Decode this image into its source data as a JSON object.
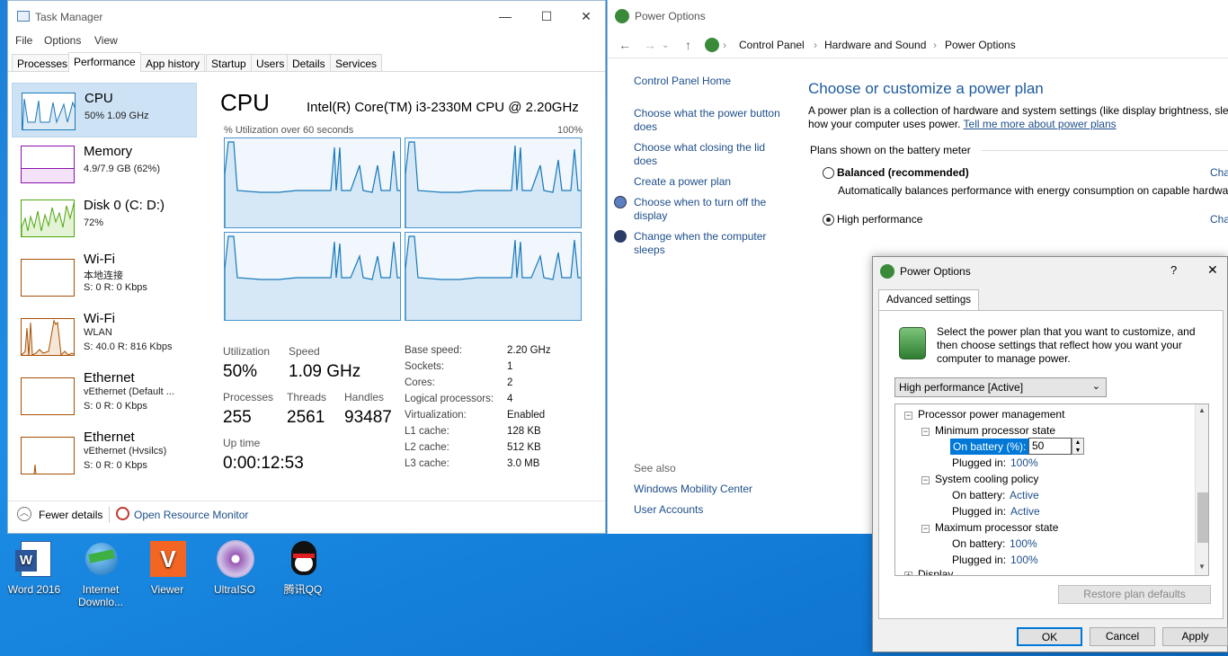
{
  "taskmanager": {
    "title": "Task Manager",
    "menu": [
      "File",
      "Options",
      "View"
    ],
    "tabs": [
      "Processes",
      "Performance",
      "App history",
      "Startup",
      "Users",
      "Details",
      "Services"
    ],
    "sidebar": [
      {
        "name": "CPU",
        "l1": "50%  1.09 GHz",
        "l2": ""
      },
      {
        "name": "Memory",
        "l1": "4.9/7.9 GB (62%)",
        "l2": ""
      },
      {
        "name": "Disk 0 (C: D:)",
        "l1": "72%",
        "l2": ""
      },
      {
        "name": "Wi-Fi",
        "l1": "本地连接",
        "l2": "S: 0 R: 0 Kbps"
      },
      {
        "name": "Wi-Fi",
        "l1": "WLAN",
        "l2": "S: 40.0 R: 816 Kbps"
      },
      {
        "name": "Ethernet",
        "l1": "vEthernet (Default ...",
        "l2": "S: 0 R: 0 Kbps"
      },
      {
        "name": "Ethernet",
        "l1": "vEthernet (Hvsilcs)",
        "l2": "S: 0 R: 0 Kbps"
      }
    ],
    "cpu": {
      "title": "CPU",
      "model": "Intel(R) Core(TM) i3-2330M CPU @ 2.20GHz",
      "util_caption": "% Utilization over 60 seconds",
      "util_max": "100%",
      "stats": {
        "utilization_label": "Utilization",
        "utilization": "50%",
        "speed_label": "Speed",
        "speed": "1.09 GHz",
        "processes_label": "Processes",
        "processes": "255",
        "threads_label": "Threads",
        "threads": "2561",
        "handles_label": "Handles",
        "handles": "93487",
        "uptime_label": "Up time",
        "uptime": "0:00:12:53"
      },
      "specs": [
        {
          "k": "Base speed:",
          "v": "2.20 GHz"
        },
        {
          "k": "Sockets:",
          "v": "1"
        },
        {
          "k": "Cores:",
          "v": "2"
        },
        {
          "k": "Logical processors:",
          "v": "4"
        },
        {
          "k": "Virtualization:",
          "v": "Enabled"
        },
        {
          "k": "L1 cache:",
          "v": "128 KB"
        },
        {
          "k": "L2 cache:",
          "v": "512 KB"
        },
        {
          "k": "L3 cache:",
          "v": "3.0 MB"
        }
      ]
    },
    "footer": {
      "fewer": "Fewer details",
      "monitor": "Open Resource Monitor"
    },
    "colors": {
      "cpu": "#1779ba",
      "memory": "#8b12ae",
      "disk": "#4da60c",
      "net": "#a74f01"
    }
  },
  "poweroptions": {
    "title": "Power Options",
    "breadcrumb": [
      "Control Panel",
      "Hardware and Sound",
      "Power Options"
    ],
    "tasks": [
      "Control Panel Home",
      "Choose what the power button does",
      "Choose what closing the lid does",
      "Create a power plan",
      "Choose when to turn off the display",
      "Change when the computer sleeps"
    ],
    "see_also": "See also",
    "see_also_links": [
      "Windows Mobility Center",
      "User Accounts"
    ],
    "heading": "Choose or customize a power plan",
    "desc1": "A power plan is a collection of hardware and system settings (like display brightness, slee",
    "desc2": "how your computer uses power.",
    "desc_link": "Tell me more about power plans",
    "plans_label": "Plans shown on the battery meter",
    "plans": [
      {
        "name": "Balanced (recommended)",
        "desc": "Automatically balances performance with energy consumption on capable hardwa",
        "change": "Cha",
        "selected": false
      },
      {
        "name": "High performance",
        "desc": "",
        "change": "Cha",
        "selected": true
      }
    ]
  },
  "advanced": {
    "title": "Power Options",
    "help": "?",
    "tab": "Advanced settings",
    "intro": [
      "Select the power plan that you want to customize, and",
      "then choose settings that reflect how you want your",
      "computer to manage power."
    ],
    "plan_select": "High performance [Active]",
    "tree": {
      "group": "Processor power management",
      "min_state": "Minimum processor state",
      "on_battery_pct_label": "On battery (%):",
      "on_battery_pct_value": "50",
      "plugged_in_label": "Plugged in:",
      "min_plugged": "100%",
      "cooling": "System cooling policy",
      "on_battery_label": "On battery:",
      "cooling_battery": "Active",
      "cooling_plugged": "Active",
      "max_state": "Maximum processor state",
      "max_battery": "100%",
      "max_plugged": "100%",
      "display": "Display"
    },
    "restore": "Restore plan defaults",
    "ok": "OK",
    "cancel": "Cancel",
    "apply": "Apply"
  },
  "desktop": [
    {
      "label": "Word 2016",
      "icon": "word-icon"
    },
    {
      "label": "Internet Downlo...",
      "icon": "idm-icon"
    },
    {
      "label": "Viewer",
      "icon": "viewer-icon"
    },
    {
      "label": "UltraISO",
      "icon": "ultraiso-icon"
    },
    {
      "label": "腾讯QQ",
      "icon": "qq-icon"
    }
  ]
}
